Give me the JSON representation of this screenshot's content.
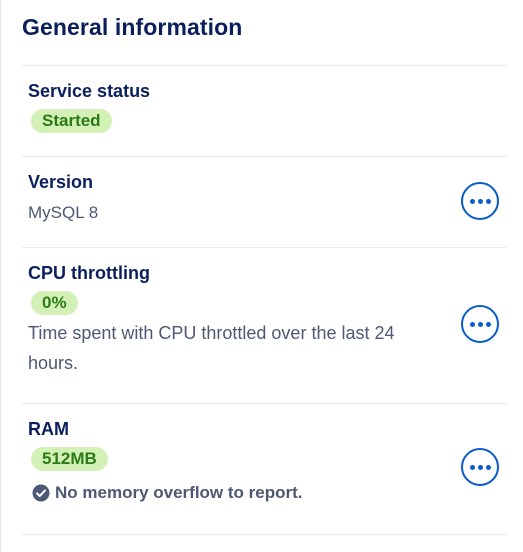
{
  "card": {
    "title": "General information"
  },
  "service_status": {
    "label": "Service status",
    "badge": "Started"
  },
  "version": {
    "label": "Version",
    "value": "MySQL 8",
    "action_icon": "more-horizontal-icon"
  },
  "cpu_throttling": {
    "label": "CPU throttling",
    "badge": "0%",
    "description": "Time spent with CPU throttled over the last 24 hours.",
    "action_icon": "more-horizontal-icon"
  },
  "ram": {
    "label": "RAM",
    "badge": "512MB",
    "status_icon": "check-circle-icon",
    "status_text": "No memory overflow to report.",
    "action_icon": "more-horizontal-icon"
  },
  "colors": {
    "heading": "#0a1f5c",
    "muted_text": "#4d5874",
    "badge_bg": "#d3f0b6",
    "badge_text": "#2c7a16",
    "action": "#0a5bcc",
    "divider": "#e9ecef"
  }
}
